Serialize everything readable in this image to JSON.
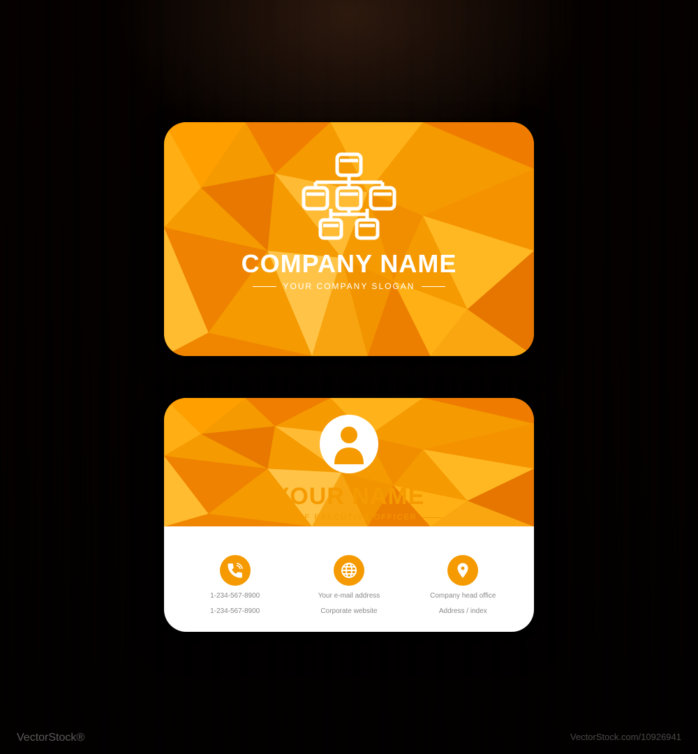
{
  "front": {
    "company_name": "COMPANY NAME",
    "slogan": "YOUR COMPANY SLOGAN"
  },
  "back": {
    "person_name": "YOUR NAME",
    "job_title": "CHIEF EXECUTIVE OFFICER",
    "contacts": [
      {
        "icon": "phone-icon",
        "line1": "1-234-567-8900",
        "line2": "1-234-567-8900"
      },
      {
        "icon": "globe-icon",
        "line1": "Your e-mail address",
        "line2": "Corporate website"
      },
      {
        "icon": "pin-icon",
        "line1": "Company head office",
        "line2": "Address / index"
      }
    ]
  },
  "watermark": {
    "left": "VectorStock®",
    "right": "VectorStock.com/10926941"
  }
}
